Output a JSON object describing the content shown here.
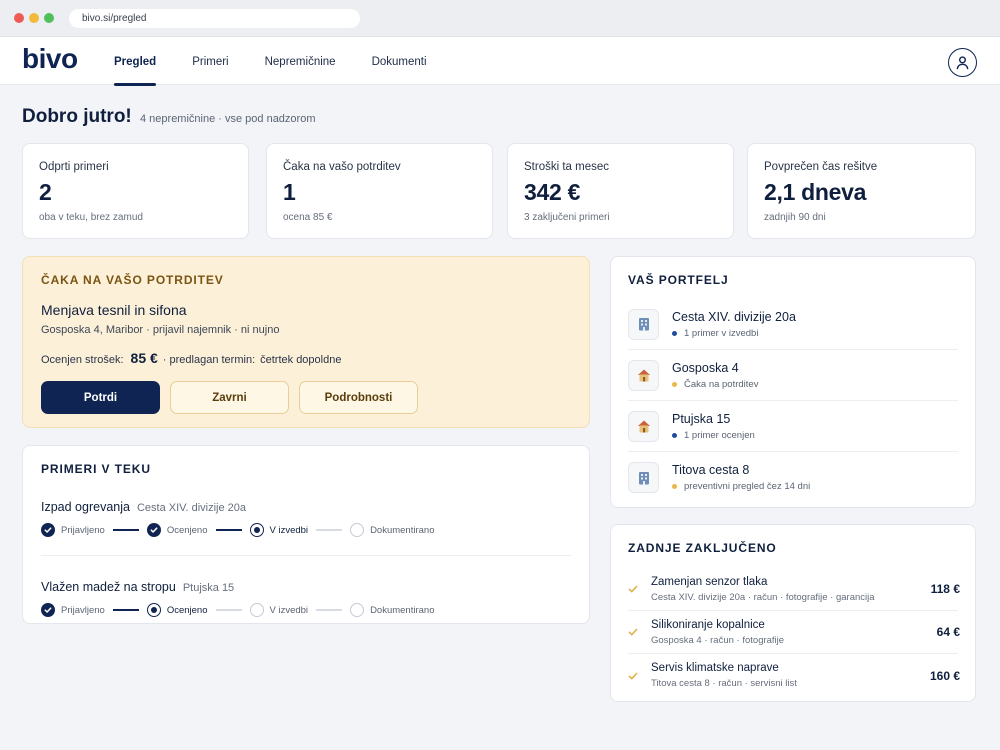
{
  "browser": {
    "url": "bivo.si/pregled"
  },
  "app": {
    "logo": "bivo",
    "nav": [
      "Pregled",
      "Primeri",
      "Nepremičnine",
      "Dokumenti"
    ],
    "active_tab": "Pregled"
  },
  "greeting": {
    "title": "Dobro jutro!",
    "subtitle": "4 nepremičnine · vse pod nadzorom"
  },
  "stats": [
    {
      "label": "Odprti primeri",
      "value": "2",
      "note": "oba v teku, brez zamud"
    },
    {
      "label": "Čaka na vašo potrditev",
      "value": "1",
      "note": "ocena 85 €"
    },
    {
      "label": "Stroški ta mesec",
      "value": "342 €",
      "note": "3 zaključeni primeri"
    },
    {
      "label": "Povprečen čas rešitve",
      "value": "2,1 dneva",
      "note": "zadnjih 90 dni"
    }
  ],
  "pending": {
    "heading": "ČAKA NA VAŠO POTRDITEV",
    "title": "Menjava tesnil in sifona",
    "subtitle": "Gosposka 4, Maribor · prijavil najemnik · ni nujno",
    "cost_label": "Ocenjen strošek:",
    "cost_value": "85 €",
    "term_label": "· predlagan termin:",
    "term_value": "četrtek dopoldne",
    "buttons": {
      "confirm": "Potrdi",
      "reject": "Zavrni",
      "details": "Podrobnosti"
    }
  },
  "in_progress": {
    "heading": "PRIMERI V TEKU",
    "cases": [
      {
        "title": "Izpad ogrevanja",
        "location": "Cesta XIV. divizije 20a",
        "steps": [
          {
            "label": "Prijavljeno",
            "state": "done"
          },
          {
            "label": "Ocenjeno",
            "state": "done"
          },
          {
            "label": "V izvedbi",
            "state": "current"
          },
          {
            "label": "Dokumentirano",
            "state": "todo"
          }
        ]
      },
      {
        "title": "Vlažen madež na stropu",
        "location": "Ptujska 15",
        "steps": [
          {
            "label": "Prijavljeno",
            "state": "done"
          },
          {
            "label": "Ocenjeno",
            "state": "current"
          },
          {
            "label": "V izvedbi",
            "state": "todo"
          },
          {
            "label": "Dokumentirano",
            "state": "todo"
          }
        ]
      }
    ]
  },
  "portfolio": {
    "heading": "VAŠ PORTFELJ",
    "items": [
      {
        "name": "Cesta XIV. divizije 20a",
        "status": "1 primer v izvedbi",
        "icon": "building-icon",
        "status_color": "#1f4e9c"
      },
      {
        "name": "Gosposka 4",
        "status": "Čaka na potrditev",
        "icon": "house-icon",
        "status_color": "#e8b84a"
      },
      {
        "name": "Ptujska 15",
        "status": "1 primer ocenjen",
        "icon": "house-icon",
        "status_color": "#1f4e9c"
      },
      {
        "name": "Titova cesta 8",
        "status": "preventivni pregled čez 14 dni",
        "icon": "building-icon",
        "status_color": "#e8b84a"
      }
    ]
  },
  "recently_closed": {
    "heading": "ZADNJE ZAKLJUČENO",
    "items": [
      {
        "title": "Zamenjan senzor tlaka",
        "meta": "Cesta XIV. divizije 20a · račun · fotografije · garancija",
        "amount": "118 €"
      },
      {
        "title": "Silikoniranje kopalnice",
        "meta": "Gosposka 4 · račun · fotografije",
        "amount": "64 €"
      },
      {
        "title": "Servis klimatske naprave",
        "meta": "Titova cesta 8 · račun · servisni list",
        "amount": "160 €"
      }
    ]
  },
  "colors": {
    "navy": "#0f2452",
    "pending_bg": "#fcf0d8",
    "gold": "#e8b84a",
    "blue_dot": "#1f4e9c"
  }
}
